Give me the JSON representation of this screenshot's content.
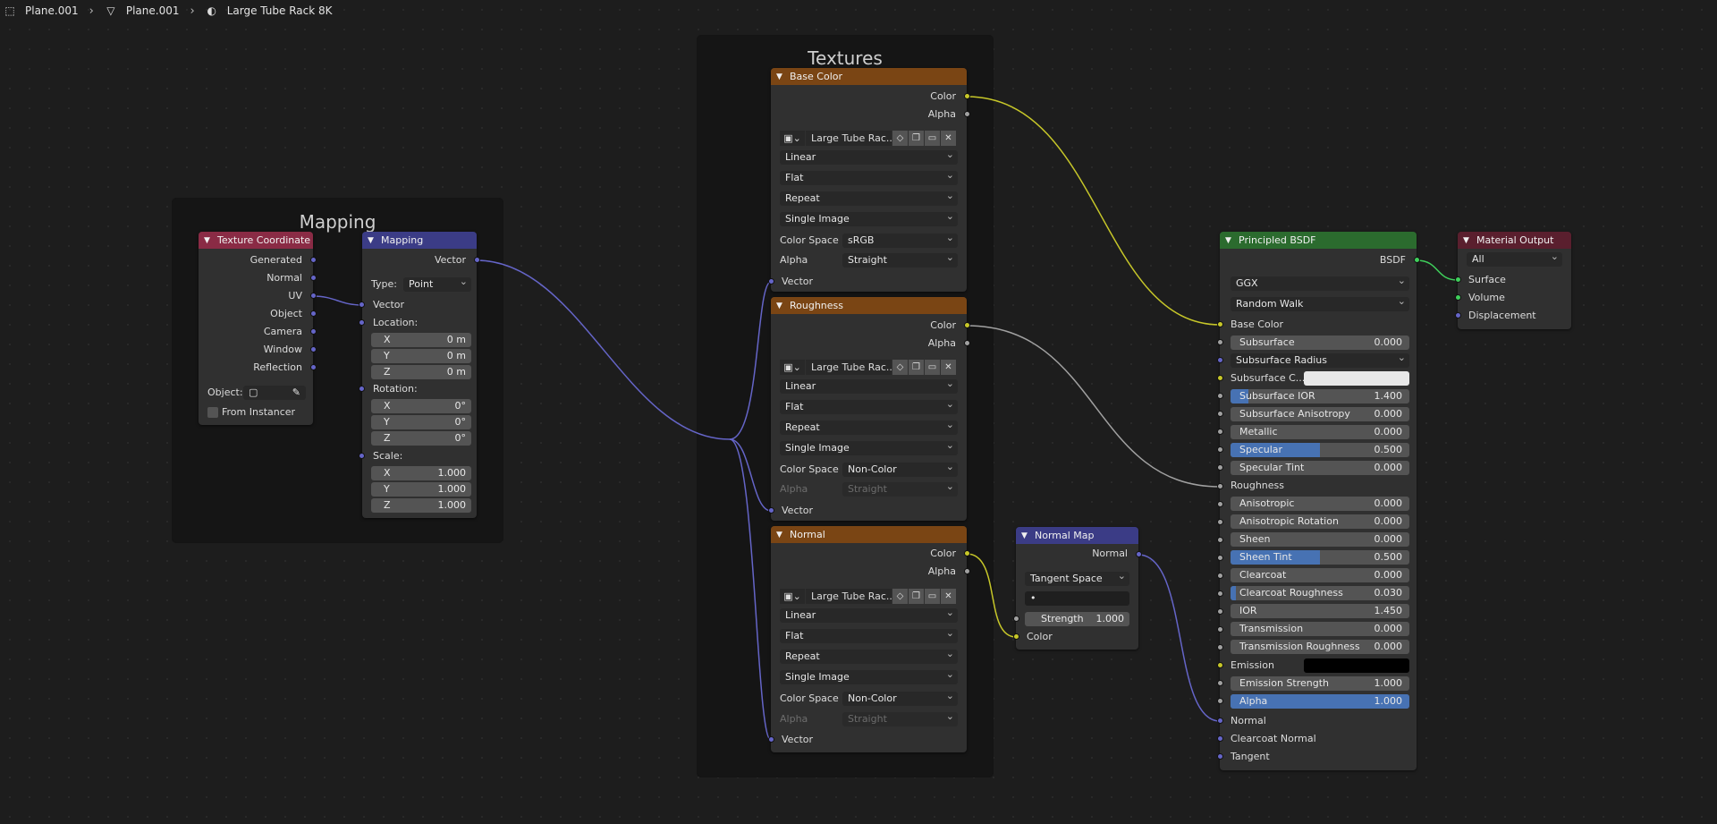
{
  "breadcrumb": {
    "items": [
      {
        "icon": "mesh-object-icon",
        "glyph": "⬚",
        "label": "Plane.001"
      },
      {
        "icon": "mesh-data-icon",
        "glyph": "▽",
        "label": "Plane.001"
      },
      {
        "icon": "material-icon",
        "glyph": "◐",
        "label": "Large Tube Rack 8K"
      }
    ],
    "separator": "›"
  },
  "frames": {
    "mapping": {
      "title": "Mapping"
    },
    "textures": {
      "title": "Textures"
    }
  },
  "texcoord": {
    "title": "Texture Coordinate",
    "outputs": [
      "Generated",
      "Normal",
      "UV",
      "Object",
      "Camera",
      "Window",
      "Reflection"
    ],
    "object_label": "Object:",
    "from_instancer": "From Instancer"
  },
  "mapping": {
    "title": "Mapping",
    "output": "Vector",
    "type_label": "Type:",
    "type_value": "Point",
    "vector_input": "Vector",
    "location_label": "Location:",
    "location": [
      {
        "axis": "X",
        "value": "0 m"
      },
      {
        "axis": "Y",
        "value": "0 m"
      },
      {
        "axis": "Z",
        "value": "0 m"
      }
    ],
    "rotation_label": "Rotation:",
    "rotation": [
      {
        "axis": "X",
        "value": "0°"
      },
      {
        "axis": "Y",
        "value": "0°"
      },
      {
        "axis": "Z",
        "value": "0°"
      }
    ],
    "scale_label": "Scale:",
    "scale": [
      {
        "axis": "X",
        "value": "1.000"
      },
      {
        "axis": "Y",
        "value": "1.000"
      },
      {
        "axis": "Z",
        "value": "1.000"
      }
    ]
  },
  "texnodes": [
    {
      "title": "Base Color",
      "out_color": "Color",
      "out_alpha": "Alpha",
      "image": "Large Tube Rac...",
      "interpolation": "Linear",
      "projection": "Flat",
      "extension": "Repeat",
      "source": "Single Image",
      "colorspace_label": "Color Space",
      "colorspace": "sRGB",
      "alpha_label": "Alpha",
      "alpha": "Straight",
      "alpha_dim": false,
      "vector_input": "Vector"
    },
    {
      "title": "Roughness",
      "out_color": "Color",
      "out_alpha": "Alpha",
      "image": "Large Tube Rac...",
      "interpolation": "Linear",
      "projection": "Flat",
      "extension": "Repeat",
      "source": "Single Image",
      "colorspace_label": "Color Space",
      "colorspace": "Non-Color",
      "alpha_label": "Alpha",
      "alpha": "Straight",
      "alpha_dim": true,
      "vector_input": "Vector"
    },
    {
      "title": "Normal",
      "out_color": "Color",
      "out_alpha": "Alpha",
      "image": "Large Tube Rac...",
      "interpolation": "Linear",
      "projection": "Flat",
      "extension": "Repeat",
      "source": "Single Image",
      "colorspace_label": "Color Space",
      "colorspace": "Non-Color",
      "alpha_label": "Alpha",
      "alpha": "Straight",
      "alpha_dim": true,
      "vector_input": "Vector"
    }
  ],
  "normalmap": {
    "title": "Normal Map",
    "output": "Normal",
    "space": "Tangent Space",
    "uv_value": "•",
    "strength_label": "Strength",
    "strength": "1.000",
    "color_input": "Color"
  },
  "bsdf": {
    "title": "Principled BSDF",
    "output": "BSDF",
    "distribution": "GGX",
    "subsurface_method": "Random Walk",
    "base_color": "Base Color",
    "subsurface": {
      "label": "Subsurface",
      "value": "0.000"
    },
    "subsurface_radius": "Subsurface Radius",
    "subsurface_color": "Subsurface C...",
    "subsurface_ior": {
      "label": "Subsurface IOR",
      "value": "1.400",
      "fill": 0.1
    },
    "subsurface_anisotropy": {
      "label": "Subsurface Anisotropy",
      "value": "0.000"
    },
    "metallic": {
      "label": "Metallic",
      "value": "0.000"
    },
    "specular": {
      "label": "Specular",
      "value": "0.500",
      "fill": 0.5
    },
    "specular_tint": {
      "label": "Specular Tint",
      "value": "0.000"
    },
    "roughness": "Roughness",
    "anisotropic": {
      "label": "Anisotropic",
      "value": "0.000"
    },
    "anisotropic_rotation": {
      "label": "Anisotropic Rotation",
      "value": "0.000"
    },
    "sheen": {
      "label": "Sheen",
      "value": "0.000"
    },
    "sheen_tint": {
      "label": "Sheen Tint",
      "value": "0.500",
      "fill": 0.5
    },
    "clearcoat": {
      "label": "Clearcoat",
      "value": "0.000"
    },
    "clearcoat_roughness": {
      "label": "Clearcoat Roughness",
      "value": "0.030",
      "fill": 0.03
    },
    "ior": {
      "label": "IOR",
      "value": "1.450"
    },
    "transmission": {
      "label": "Transmission",
      "value": "0.000"
    },
    "transmission_roughness": {
      "label": "Transmission Roughness",
      "value": "0.000"
    },
    "emission": "Emission",
    "emission_strength": {
      "label": "Emission Strength",
      "value": "1.000"
    },
    "alpha": {
      "label": "Alpha",
      "value": "1.000",
      "fill": 1.0
    },
    "normal": "Normal",
    "clearcoat_normal": "Clearcoat Normal",
    "tangent": "Tangent"
  },
  "output": {
    "title": "Material Output",
    "target": "All",
    "inputs": [
      "Surface",
      "Volume",
      "Displacement"
    ]
  },
  "colors": {
    "vector_link": "#6565c8",
    "color_link": "#c7c729",
    "gray_link": "#a1a1a1",
    "shader_link": "#3fcf5b",
    "subsurface_color": "#e8e8e8",
    "emission_color": "#000000"
  }
}
